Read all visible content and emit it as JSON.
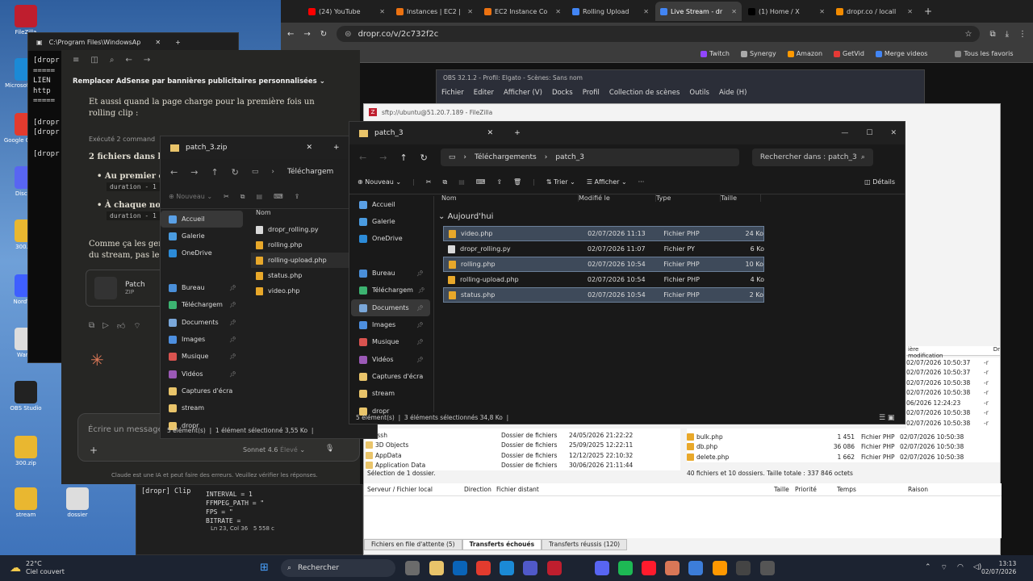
{
  "desktop": {
    "icons": [
      {
        "label": "FileZilla",
        "color": "#bf1e2e"
      },
      {
        "label": "Microsoft Edge",
        "color": "#1b8ad6"
      },
      {
        "label": "Google Chrome",
        "color": "#e33b2e"
      },
      {
        "label": "Discord",
        "color": "#5865f2"
      },
      {
        "label": "300.zip",
        "color": "#e9b730"
      },
      {
        "label": "NordVPN",
        "color": "#3e5fff"
      },
      {
        "label": "Wamp",
        "color": "#ddd"
      },
      {
        "label": "OBS Studio",
        "color": "#222"
      },
      {
        "label": "300.zip",
        "color": "#e9b730"
      },
      {
        "label": "stream",
        "color": "#e9b730"
      },
      {
        "label": "dossier",
        "color": "#ddd"
      }
    ]
  },
  "chrome": {
    "tabs": [
      {
        "label": "(24) YouTube",
        "color": "#ff0000"
      },
      {
        "label": "Instances | EC2 |",
        "color": "#ec7211"
      },
      {
        "label": "EC2 Instance Co",
        "color": "#ec7211"
      },
      {
        "label": "Rolling Upload",
        "color": "#4285f4"
      },
      {
        "label": "Live Stream - dr",
        "color": "#4285f4"
      },
      {
        "label": "(1) Home / X",
        "color": "#000000"
      },
      {
        "label": "dropr.co / locall",
        "color": "#f28b00"
      }
    ],
    "url": "dropr.co/v/2c732f2c",
    "bookmarks": [
      {
        "label": "Twitch",
        "color": "#9146ff"
      },
      {
        "label": "Synergy",
        "color": "#aaaaaa"
      },
      {
        "label": "Amazon",
        "color": "#ff9900"
      },
      {
        "label": "GetVid",
        "color": "#e53935"
      },
      {
        "label": "Merge videos",
        "color": "#4285f4"
      },
      {
        "label": "Tous les favoris",
        "color": "#888888"
      }
    ]
  },
  "terminal": {
    "title": "C:\\Program Files\\WindowsAp",
    "lines": [
      "[dropr",
      "=====",
      "  LIEN",
      "  http",
      "=====",
      "[dropr",
      "[dropr",
      "[dropr"
    ]
  },
  "claude": {
    "title": "Remplacer AdSense par bannières publicitaires personnalisées",
    "p1": "Et aussi quand la page charge pour la première fois un rolling clip :",
    "exec": "Exécuté 2 command",
    "p2": "2 fichiers dans le z",
    "b1": "Au premier c",
    "b1code": "duration - 1",
    "b2": "À chaque nou",
    "b2code": "duration - 1",
    "p3": "Comme ça les gen",
    "p3b": "du stream, pas le",
    "attach_name": "Patch",
    "attach_type": "ZIP",
    "input_placeholder": "Écrire un message",
    "model": "Sonnet 4.6",
    "effort": "Élevé",
    "disclaimer": "Claude est une IA et peut faire des erreurs. Veuillez vérifier les réponses."
  },
  "obs": {
    "title": "OBS 32.1.2 - Profil: Elgato - Scènes: Sans nom",
    "menu": [
      "Fichier",
      "Editer",
      "Afficher (V)",
      "Docks",
      "Profil",
      "Collection de scènes",
      "Outils",
      "Aide (H)"
    ]
  },
  "terminal2": {
    "title": "[dropr] Clip",
    "lines": [
      "INTERVAL       = 1",
      "FFMPEG_PATH    = \"",
      "FPS            = \"",
      "BITRATE        = "
    ],
    "status": "Ln 23, Col 36",
    "size": "5 558 c"
  },
  "explorer_zip": {
    "title": "patch_3.zip",
    "crumb": "Téléchargem",
    "new": "Nouveau",
    "sidebar": [
      "Accueil",
      "Galerie",
      "OneDrive",
      "Bureau",
      "Téléchargem",
      "Documents",
      "Images",
      "Musique",
      "Vidéos",
      "Captures d'écra",
      "stream",
      "dropr"
    ],
    "col_name": "Nom",
    "files": [
      "dropr_rolling.py",
      "rolling.php",
      "rolling-upload.php",
      "status.php",
      "video.php"
    ],
    "status_count": "5 élément(s)",
    "status_sel": "1 élément sélectionné  3,55 Ko"
  },
  "explorer": {
    "title": "patch_3",
    "crumb1": "Téléchargements",
    "crumb2": "patch_3",
    "search": "Rechercher dans : patch_3",
    "new": "Nouveau",
    "sort": "Trier",
    "view": "Afficher",
    "details": "Détails",
    "sidebar": [
      "Accueil",
      "Galerie",
      "OneDrive",
      "Bureau",
      "Téléchargem",
      "Documents",
      "Images",
      "Musique",
      "Vidéos",
      "Captures d'écra",
      "stream",
      "dropr"
    ],
    "columns": [
      "Nom",
      "Modifié le",
      "Type",
      "Taille"
    ],
    "group": "Aujourd'hui",
    "files": [
      {
        "name": "video.php",
        "date": "02/07/2026 11:13",
        "type": "Fichier PHP",
        "size": "24 Ko",
        "sel": true,
        "kind": "php"
      },
      {
        "name": "dropr_rolling.py",
        "date": "02/07/2026 11:07",
        "type": "Fichier PY",
        "size": "6 Ko",
        "sel": false,
        "kind": "py"
      },
      {
        "name": "rolling.php",
        "date": "02/07/2026 10:54",
        "type": "Fichier PHP",
        "size": "10 Ko",
        "sel": true,
        "kind": "php"
      },
      {
        "name": "rolling-upload.php",
        "date": "02/07/2026 10:54",
        "type": "Fichier PHP",
        "size": "4 Ko",
        "sel": false,
        "kind": "php"
      },
      {
        "name": "status.php",
        "date": "02/07/2026 10:54",
        "type": "Fichier PHP",
        "size": "2 Ko",
        "sel": true,
        "kind": "php"
      }
    ],
    "status_count": "5 élément(s)",
    "status_sel": "3 éléments sélectionnés  34,8 Ko"
  },
  "filezilla": {
    "title": "sftp://ubuntu@51.20.7.189 - FileZilla",
    "remote_hdr": [
      "ière modification",
      "Dr"
    ],
    "remote_dates": [
      "02/07/2026 10:50:37",
      "02/07/2026 10:50:37",
      "02/07/2026 10:50:38",
      "02/07/2026 10:50:38",
      "06/2026 12:24:23",
      "02/07/2026 10:50:38",
      "02/07/2026 10:50:38",
      "02/07/2026 10:50:38"
    ],
    "remote_files": [
      {
        "name": "bulk.php",
        "size": "1 451",
        "type": "Fichier PHP",
        "date": "02/07/2026 10:50:38"
      },
      {
        "name": "db.php",
        "size": "36 086",
        "type": "Fichier PHP",
        "date": "02/07/2026 10:50:38"
      },
      {
        "name": "delete.php",
        "size": "1 662",
        "type": "Fichier PHP",
        "date": "02/07/2026 10:50:38"
      }
    ],
    "local_files": [
      {
        "name": ".ssh",
        "type": "Dossier de fichiers",
        "date": "24/05/2026 21:22:22"
      },
      {
        "name": "3D Objects",
        "type": "Dossier de fichiers",
        "date": "25/09/2025 12:22:11"
      },
      {
        "name": "AppData",
        "type": "Dossier de fichiers",
        "date": "12/12/2025 22:10:32"
      },
      {
        "name": "Application Data",
        "type": "Dossier de fichiers",
        "date": "30/06/2026 21:11:44"
      }
    ],
    "local_status": "Sélection de 1 dossier.",
    "remote_status": "40 fichiers et 10 dossiers. Taille totale : 337 846 octets",
    "queue_cols": [
      "Serveur / Fichier local",
      "Direction",
      "Fichier distant",
      "Taille",
      "Priorité",
      "Temps",
      "Raison"
    ],
    "queue_tabs": [
      "Fichiers en file d'attente (5)",
      "Transferts échoués",
      "Transferts réussis (120)"
    ]
  },
  "taskbar": {
    "weather_temp": "22°C",
    "weather_desc": "Ciel couvert",
    "search": "Rechercher",
    "time": "13:13",
    "date": "02/07/2026"
  }
}
